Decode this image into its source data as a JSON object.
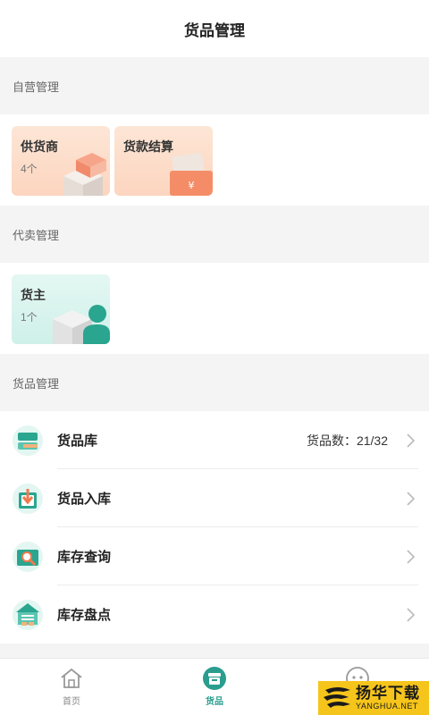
{
  "header": {
    "title": "货品管理"
  },
  "self_operated": {
    "heading": "自营管理",
    "cards": [
      {
        "title": "供货商",
        "subtitle": "4个"
      },
      {
        "title": "货款结算",
        "subtitle": ""
      }
    ]
  },
  "consignment": {
    "heading": "代卖管理",
    "cards": [
      {
        "title": "货主",
        "subtitle": "1个"
      }
    ]
  },
  "goods": {
    "heading": "货品管理",
    "items": [
      {
        "label": "货品库",
        "extra": "货品数：21/32"
      },
      {
        "label": "货品入库",
        "extra": ""
      },
      {
        "label": "库存查询",
        "extra": ""
      },
      {
        "label": "库存盘点",
        "extra": ""
      }
    ]
  },
  "tabbar": {
    "tabs": [
      {
        "label": "首页",
        "icon": "home-icon"
      },
      {
        "label": "货品",
        "icon": "goods-icon"
      },
      {
        "label": "",
        "icon": "chat-icon"
      }
    ]
  },
  "watermark": {
    "cn": "扬华下载",
    "en": "YANGHUA.NET"
  },
  "colors": {
    "accent": "#2a9d8f",
    "orange_card": "#fcd5bf",
    "teal_card": "#cff0e9",
    "watermark_bg": "#f6c51c"
  }
}
